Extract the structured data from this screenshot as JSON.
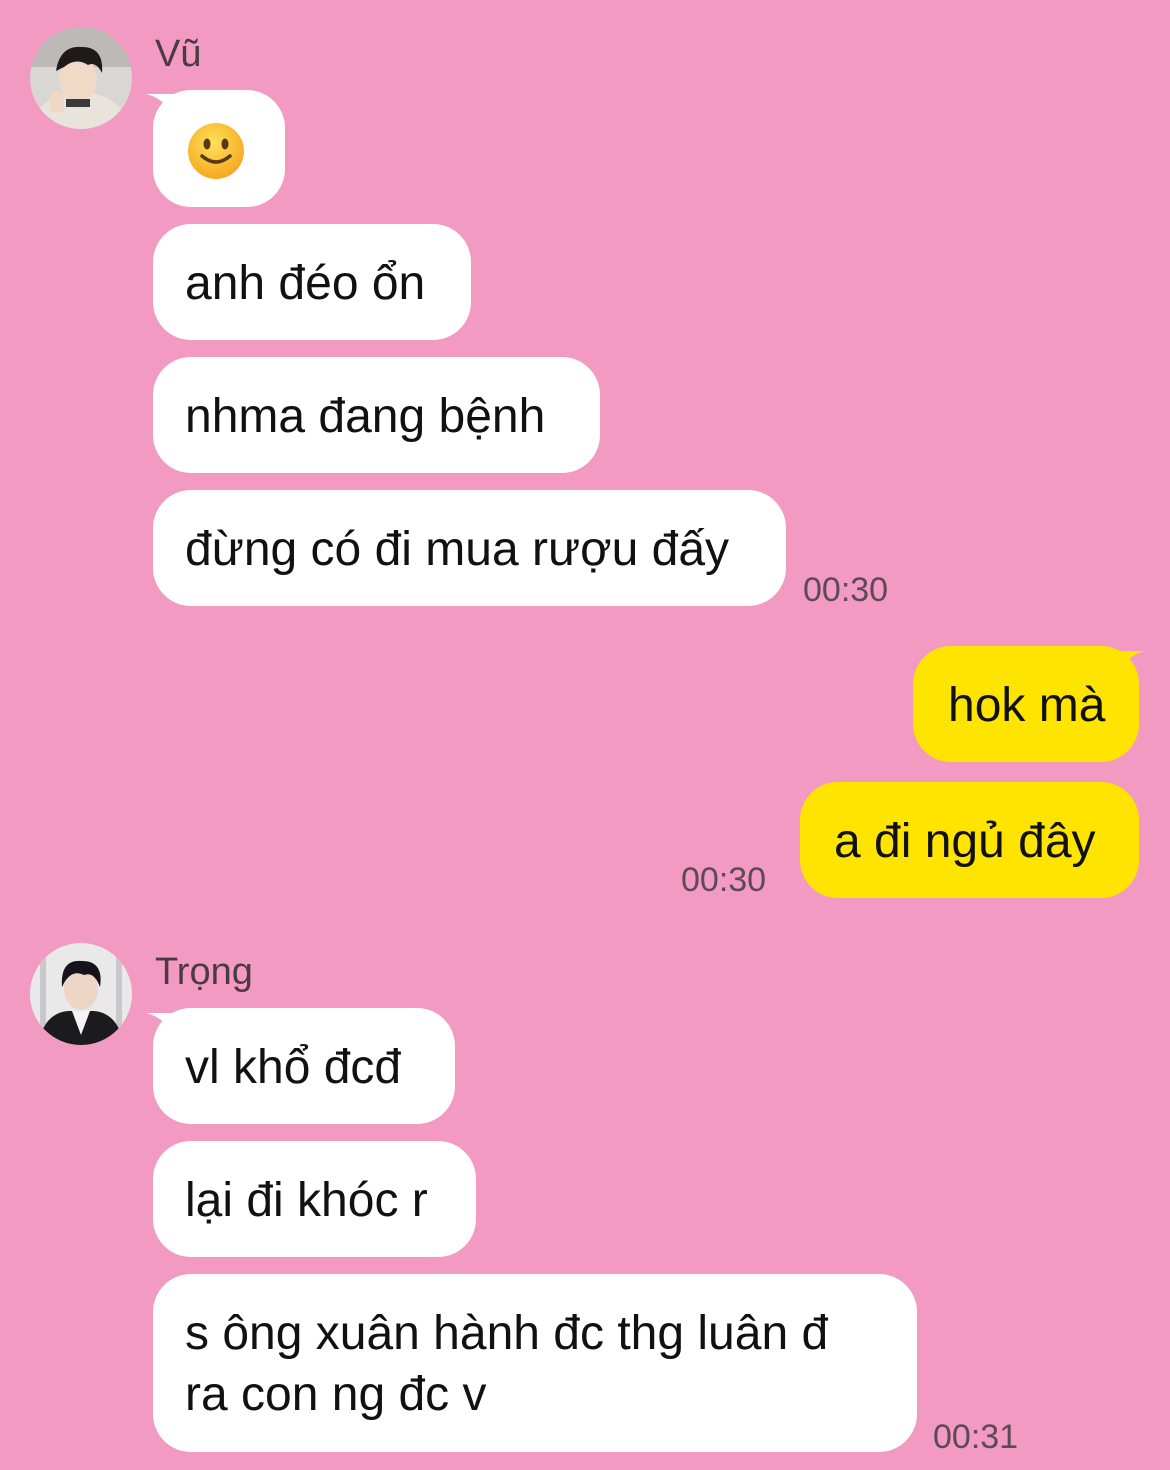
{
  "conversation": {
    "groups": [
      {
        "sender": "Vũ",
        "avatar": "avatar-vu",
        "messages": [
          {
            "type": "emoji",
            "emoji_name": "slightly-smiling-face-icon",
            "text": "🙂"
          },
          {
            "type": "text",
            "text": "anh đéo ổn"
          },
          {
            "type": "text",
            "text": "nhma đang bệnh"
          },
          {
            "type": "text",
            "text": "đừng có đi mua rượu đấy"
          }
        ],
        "time": "00:30"
      },
      {
        "sender": "me",
        "messages": [
          {
            "type": "text",
            "text": "hok mà"
          },
          {
            "type": "text",
            "text": "a đi ngủ đây"
          }
        ],
        "time": "00:30"
      },
      {
        "sender": "Trọng",
        "avatar": "avatar-trong",
        "messages": [
          {
            "type": "text",
            "text": "vl khổ đcđ"
          },
          {
            "type": "text",
            "text": "lại đi khóc r"
          },
          {
            "type": "text",
            "text": "s ông xuân hành đc thg luân đ ra con ng đc v",
            "lines": [
              "s ông xuân hành đc thg luân đ",
              "ra con ng đc v"
            ]
          }
        ],
        "time": "00:31"
      }
    ]
  },
  "colors": {
    "background": "#f29ac2",
    "incoming_bubble": "#ffffff",
    "outgoing_bubble": "#ffe400",
    "text": "#111111",
    "timestamp": "#5c4a55"
  }
}
